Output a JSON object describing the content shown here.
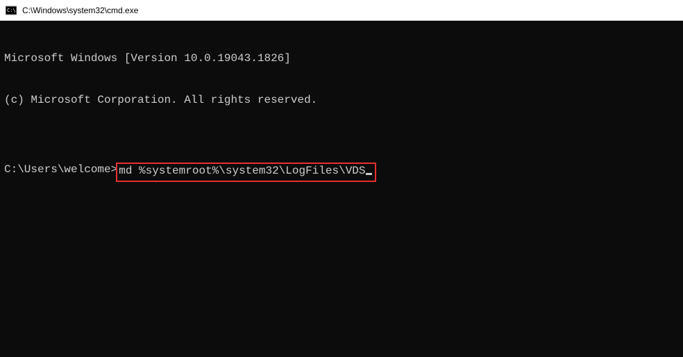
{
  "titleBar": {
    "title": "C:\\Windows\\system32\\cmd.exe"
  },
  "terminal": {
    "line1": "Microsoft Windows [Version 10.0.19043.1826]",
    "line2": "(c) Microsoft Corporation. All rights reserved.",
    "blank": "",
    "prompt": "C:\\Users\\welcome>",
    "command": "md %systemroot%\\system32\\LogFiles\\VDS"
  }
}
